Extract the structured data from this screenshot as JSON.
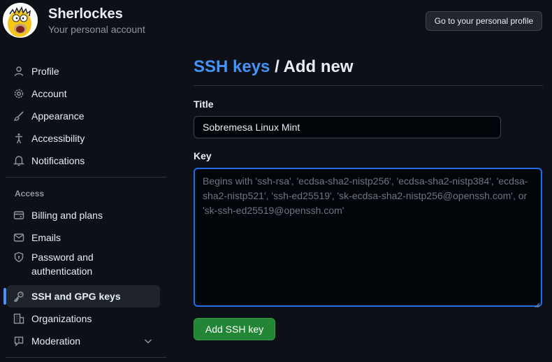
{
  "account": {
    "name": "Sherlockes",
    "subtitle": "Your personal account",
    "profile_button": "Go to your personal profile"
  },
  "sidebar": {
    "items": [
      {
        "label": "Profile",
        "icon": "person-icon"
      },
      {
        "label": "Account",
        "icon": "gear-icon"
      },
      {
        "label": "Appearance",
        "icon": "paintbrush-icon"
      },
      {
        "label": "Accessibility",
        "icon": "accessibility-icon"
      },
      {
        "label": "Notifications",
        "icon": "bell-icon"
      }
    ],
    "access_section": {
      "title": "Access",
      "items": [
        {
          "label": "Billing and plans",
          "icon": "credit-card-icon"
        },
        {
          "label": "Emails",
          "icon": "mail-icon"
        },
        {
          "label": "Password and authentication",
          "icon": "shield-lock-icon"
        },
        {
          "label": "SSH and GPG keys",
          "icon": "key-icon",
          "active": true
        },
        {
          "label": "Organizations",
          "icon": "organization-icon"
        },
        {
          "label": "Moderation",
          "icon": "report-icon",
          "expandable": true
        }
      ]
    }
  },
  "main": {
    "breadcrumb_link": "SSH keys",
    "breadcrumb_separator": " / ",
    "breadcrumb_current": "Add new",
    "title_field": {
      "label": "Title",
      "value": "Sobremesa Linux Mint"
    },
    "key_field": {
      "label": "Key",
      "value": "",
      "placeholder": "Begins with 'ssh-rsa', 'ecdsa-sha2-nistp256', 'ecdsa-sha2-nistp384', 'ecdsa-sha2-nistp521', 'ssh-ed25519', 'sk-ecdsa-sha2-nistp256@openssh.com', or 'sk-ssh-ed25519@openssh.com'"
    },
    "submit_label": "Add SSH key"
  },
  "colors": {
    "background": "#0d1117",
    "accent": "#4493f8",
    "primary_button": "#238636",
    "muted_text": "#8d96a0"
  }
}
